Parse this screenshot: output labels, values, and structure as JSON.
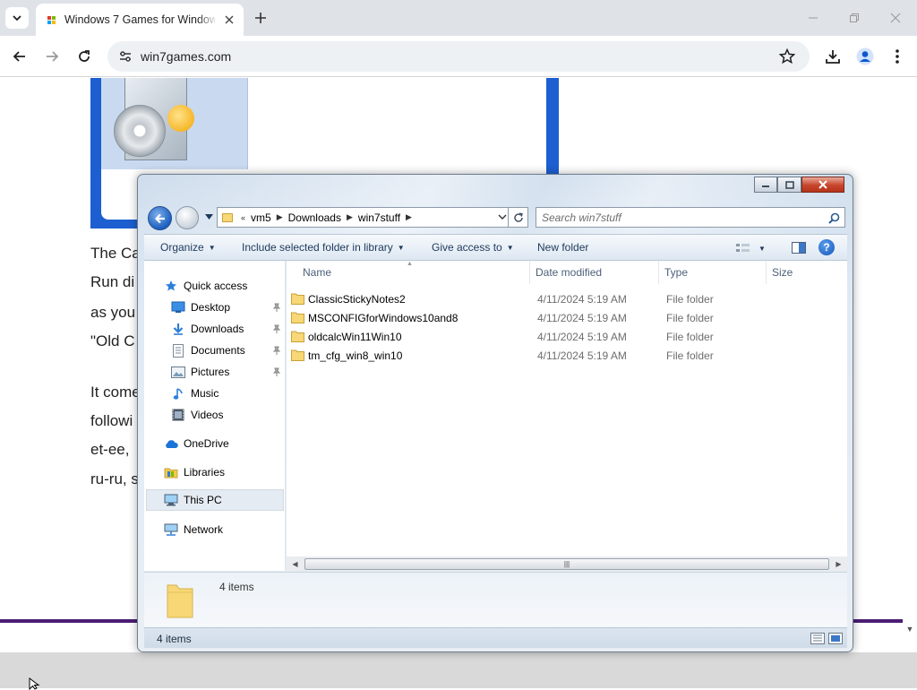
{
  "browser": {
    "tab_title": "Windows 7 Games for Windows 11 and 10",
    "url": "win7games.com",
    "new_tab_icon": "plus-icon",
    "controls": [
      "minimize-icon",
      "restore-icon",
      "close-icon"
    ]
  },
  "webpage": {
    "lines": [
      "The Ca",
      "Run di",
      "as you",
      "\"Old C",
      "It come",
      "followi",
      "et-ee,",
      "ru-ru, s"
    ],
    "accent": "#1d5fd0",
    "footer_bar": "#4b1d74"
  },
  "explorer": {
    "address": {
      "overflow": "«",
      "segments": [
        "vm5",
        "Downloads",
        "win7stuff"
      ]
    },
    "search": {
      "placeholder": "Search win7stuff"
    },
    "commands": {
      "organize": "Organize",
      "include": "Include selected folder in library",
      "share": "Give access to",
      "new_folder": "New folder"
    },
    "nav": {
      "quick_access": "Quick access",
      "desktop": "Desktop",
      "downloads": "Downloads",
      "documents": "Documents",
      "pictures": "Pictures",
      "music": "Music",
      "videos": "Videos",
      "onedrive": "OneDrive",
      "libraries": "Libraries",
      "this_pc": "This PC",
      "network": "Network"
    },
    "columns": {
      "name": "Name",
      "date": "Date modified",
      "type": "Type",
      "size": "Size"
    },
    "files": [
      {
        "name": "ClassicStickyNotes2",
        "date": "4/11/2024 5:19 AM",
        "type": "File folder"
      },
      {
        "name": "MSCONFIGforWindows10and8",
        "date": "4/11/2024 5:19 AM",
        "type": "File folder"
      },
      {
        "name": "oldcalcWin11Win10",
        "date": "4/11/2024 5:19 AM",
        "type": "File folder"
      },
      {
        "name": "tm_cfg_win8_win10",
        "date": "4/11/2024 5:19 AM",
        "type": "File folder"
      }
    ],
    "details_count": "4 items",
    "status_count": "4 items",
    "folder_color": "#f7d776"
  }
}
